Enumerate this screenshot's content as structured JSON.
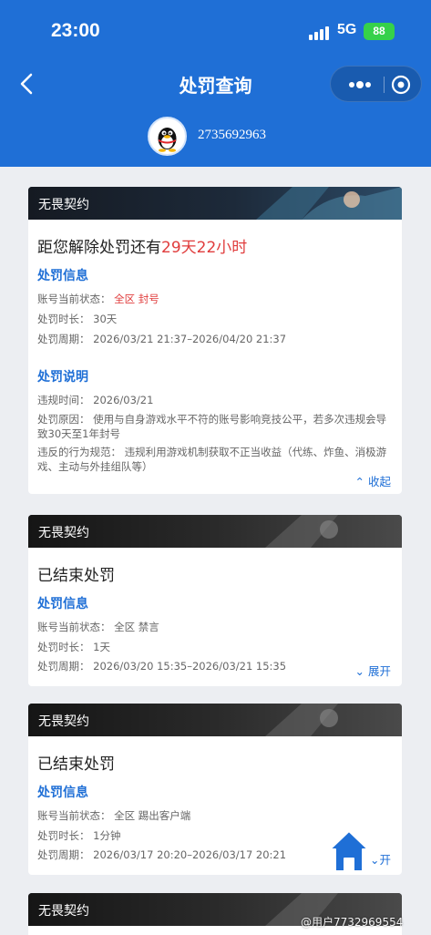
{
  "status_bar": {
    "time": "23:00",
    "network": "5G",
    "battery": "88"
  },
  "nav": {
    "title": "处罚查询"
  },
  "account": {
    "number": "2735692963"
  },
  "cards": [
    {
      "banner": "无畏契约",
      "headline_prefix": "距您解除处罚还有",
      "headline_highlight": "29天22小时",
      "info_title": "处罚信息",
      "status_label": "账号当前状态：",
      "status_value": "全区 封号",
      "duration_label": "处罚时长：",
      "duration_value": "30天",
      "period_label": "处罚周期：",
      "period_value": "2026/03/21 21:37–2026/04/20 21:37",
      "desc_title": "处罚说明",
      "violation_time_label": "违规时间：",
      "violation_time_value": "2026/03/21",
      "reason_label": "处罚原因：",
      "reason_value": "使用与自身游戏水平不符的账号影响竞技公平，若多次违规会导致30天至1年封号",
      "rule_label": "违反的行为规范：",
      "rule_value": "违规利用游戏机制获取不正当收益（代练、炸鱼、消极游戏、主动与外挂组队等）",
      "toggle": "收起"
    },
    {
      "banner": "无畏契约",
      "headline": "已结束处罚",
      "info_title": "处罚信息",
      "status_label": "账号当前状态：",
      "status_value": "全区 禁言",
      "duration_label": "处罚时长：",
      "duration_value": "1天",
      "period_label": "处罚周期：",
      "period_value": "2026/03/20 15:35–2026/03/21 15:35",
      "toggle": "展开"
    },
    {
      "banner": "无畏契约",
      "headline": "已结束处罚",
      "info_title": "处罚信息",
      "status_label": "账号当前状态：",
      "status_value": "全区 踢出客户端",
      "duration_label": "处罚时长：",
      "duration_value": "1分钟",
      "period_label": "处罚周期：",
      "period_value": "2026/03/17 20:20–2026/03/17 20:21",
      "toggle": "开"
    },
    {
      "banner": "无畏契约"
    }
  ],
  "watermark": "@用户7732969554",
  "colors": {
    "header": "#1f6fd6",
    "accent": "#1f6fd6",
    "highlight": "#e03c3c",
    "battery": "#36d14a"
  }
}
